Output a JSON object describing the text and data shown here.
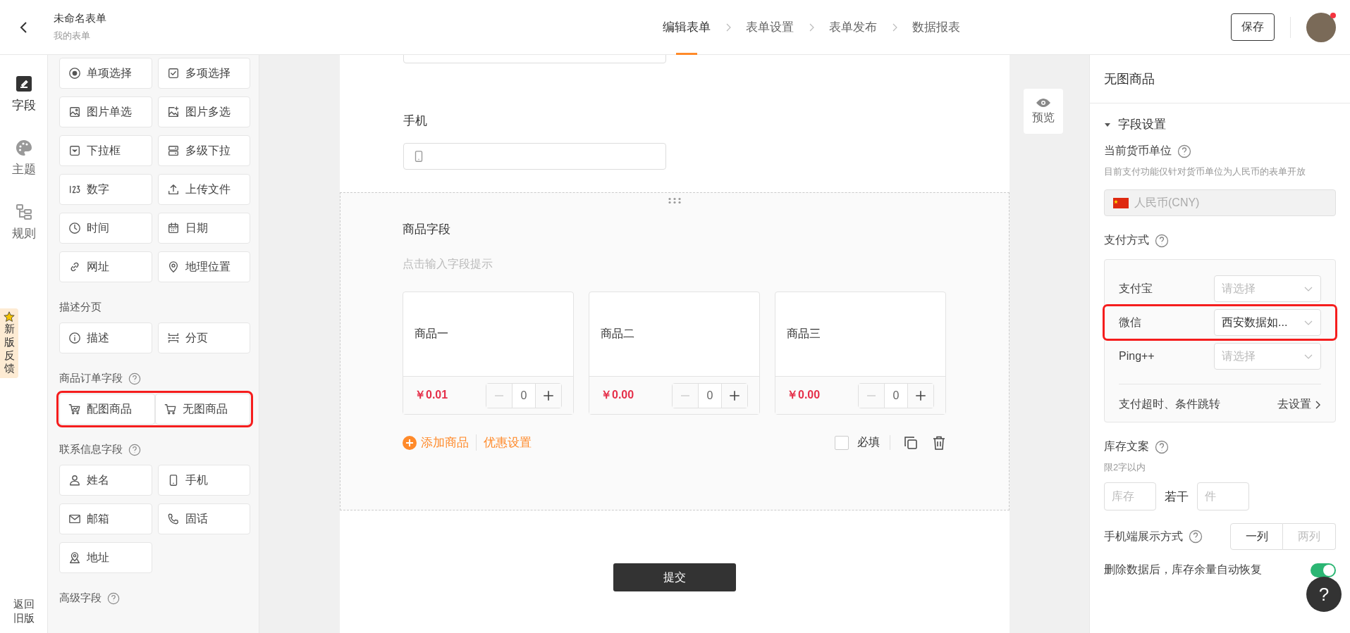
{
  "header": {
    "title": "未命名表单",
    "subtitle": "我的表单",
    "steps": [
      {
        "label": "编辑表单",
        "selected": true
      },
      {
        "label": "表单设置",
        "selected": false
      },
      {
        "label": "表单发布",
        "selected": false
      },
      {
        "label": "数据报表",
        "selected": false
      }
    ],
    "save_button": "保存",
    "avatar_unread": true
  },
  "nav": {
    "items": [
      {
        "label": "字段",
        "kind": "edit",
        "selected": true
      },
      {
        "label": "主题",
        "kind": "palette",
        "selected": false
      },
      {
        "label": "规则",
        "kind": "rules",
        "selected": false
      }
    ],
    "feedback": "新版反馈",
    "back_old": "返回旧版"
  },
  "palette": {
    "sections": [
      {
        "items": [
          {
            "label": "单项选择",
            "kind": "radio"
          },
          {
            "label": "多项选择",
            "kind": "checkbox"
          },
          {
            "label": "图片单选",
            "kind": "image"
          },
          {
            "label": "图片多选",
            "kind": "image-multi"
          },
          {
            "label": "下拉框",
            "kind": "dropdown"
          },
          {
            "label": "多级下拉",
            "kind": "cascade"
          },
          {
            "label": "数字",
            "kind": "number"
          },
          {
            "label": "上传文件",
            "kind": "upload"
          },
          {
            "label": "时间",
            "kind": "clock"
          },
          {
            "label": "日期",
            "kind": "calendar"
          },
          {
            "label": "网址",
            "kind": "link"
          },
          {
            "label": "地理位置",
            "kind": "pin"
          }
        ]
      },
      {
        "title": "描述分页",
        "items": [
          {
            "label": "描述",
            "kind": "info"
          },
          {
            "label": "分页",
            "kind": "pagebreak"
          }
        ]
      },
      {
        "title": "商品订单字段",
        "help": true,
        "highlighted": true,
        "items": [
          {
            "label": "配图商品",
            "kind": "cart-image"
          },
          {
            "label": "无图商品",
            "kind": "cart"
          }
        ]
      },
      {
        "title": "联系信息字段",
        "help": true,
        "items": [
          {
            "label": "姓名",
            "kind": "person"
          },
          {
            "label": "手机",
            "kind": "phone"
          },
          {
            "label": "邮箱",
            "kind": "mail"
          },
          {
            "label": "固话",
            "kind": "telephone"
          },
          {
            "label": "地址",
            "kind": "address"
          }
        ]
      },
      {
        "title": "高级字段",
        "help": true
      }
    ]
  },
  "form": {
    "phone_label": "手机",
    "product_field": {
      "title": "商品字段",
      "hint": "点击输入字段提示",
      "products": [
        {
          "name": "商品一",
          "price": "￥0.01",
          "quantity": "0"
        },
        {
          "name": "商品二",
          "price": "￥0.00",
          "quantity": "0"
        },
        {
          "name": "商品三",
          "price": "￥0.00",
          "quantity": "0"
        }
      ],
      "add_label": "添加商品",
      "discount_label": "优惠设置",
      "required_label": "必填",
      "required": false
    },
    "submit": "提交",
    "preview": "预览"
  },
  "settings": {
    "title": "无图商品",
    "section": "字段设置",
    "expanded": true,
    "currency_label": "当前货币单位",
    "currency_note": "目前支付功能仅针对货币单位为人民币的表单开放",
    "currency_value": "人民币(CNY)",
    "payment_label": "支付方式",
    "payment_methods": [
      {
        "name": "支付宝",
        "placeholder": "请选择"
      },
      {
        "name": "微信",
        "value": "西安数据如...",
        "highlighted": true
      },
      {
        "name": "Ping++",
        "placeholder": "请选择"
      }
    ],
    "payment_more": "支付超时、条件跳转",
    "payment_more_link": "去设置",
    "stock_label": "库存文案",
    "stock_note": "限2字以内",
    "stock_prefix_placeholder": "库存",
    "stock_middle": "若干",
    "stock_suffix_placeholder": "件",
    "mobile_label": "手机端展示方式",
    "mobile_options": [
      {
        "label": "一列",
        "selected": true
      },
      {
        "label": "两列",
        "selected": false
      }
    ],
    "restore_label": "删除数据后，库存余量自动恢复",
    "restore_on": true
  },
  "help_button": "?"
}
